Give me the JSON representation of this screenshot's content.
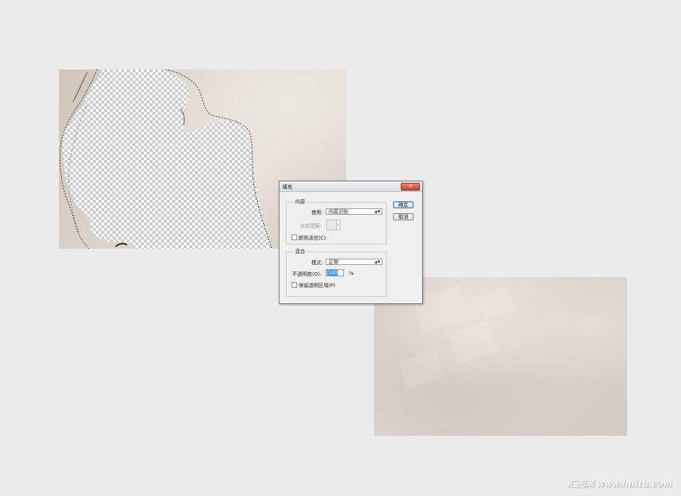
{
  "dialog": {
    "title": "填充",
    "close_icon": "close-icon",
    "content_group": "内容",
    "use_label": "使用:",
    "use_value": "内容识别",
    "custom_pattern_label": "自定图案:",
    "color_adapt_label": "颜色适应(C)",
    "color_adapt_checked": false,
    "blend_group": "混合",
    "mode_label": "模式:",
    "mode_value": "正常",
    "opacity_label": "不透明度(O):",
    "opacity_value": "100",
    "opacity_unit": "%",
    "preserve_label": "保留透明区域(P)",
    "preserve_checked": false,
    "ok_label": "确定",
    "cancel_label": "取消"
  },
  "watermark": "汇图网 www.huitu.com",
  "colors": {
    "page_bg": "#ececec",
    "close_button": "#c8402b",
    "selection_highlight": "#3399ff"
  }
}
